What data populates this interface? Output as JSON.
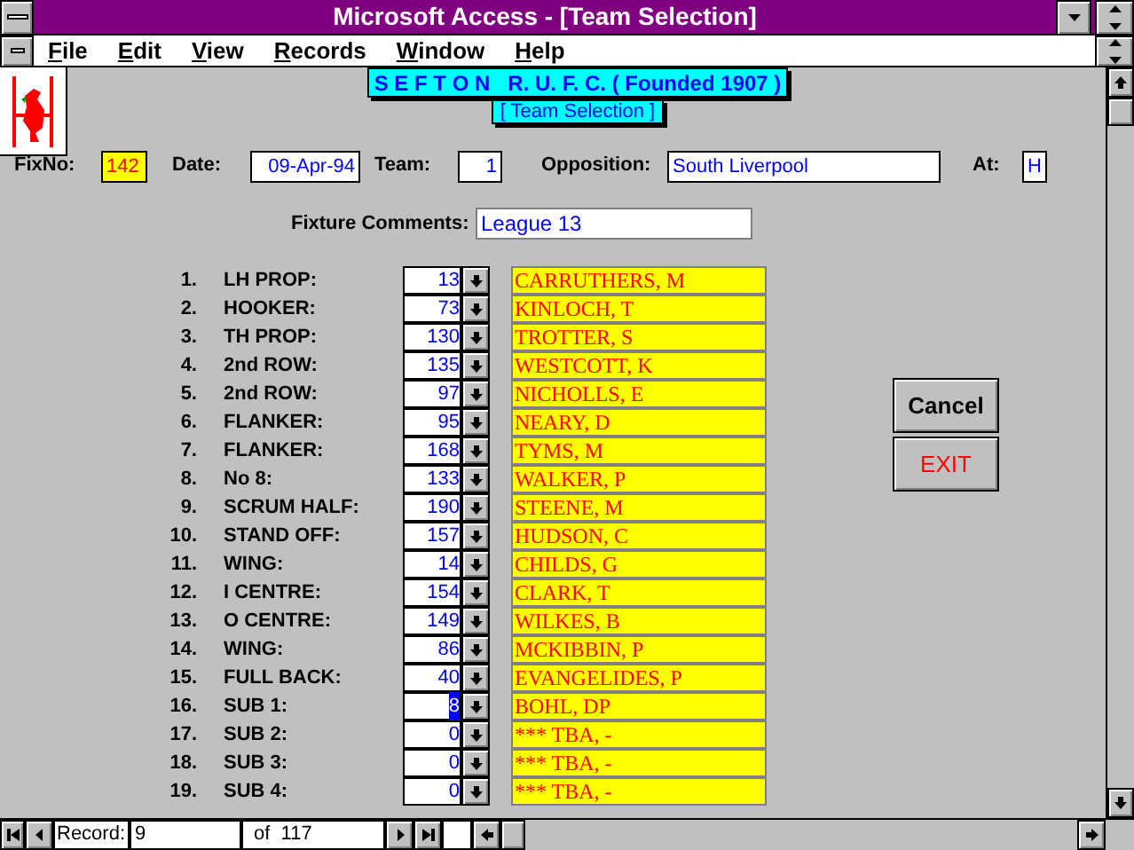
{
  "window": {
    "title": "Microsoft Access - [Team Selection]"
  },
  "menu": [
    "File",
    "Edit",
    "View",
    "Records",
    "Window",
    "Help"
  ],
  "form": {
    "club_title": "S E F T O N   R. U. F. C. ( Founded 1907 )",
    "subtitle": "[ Team Selection ]",
    "fields": [
      {
        "label": "FixNo:",
        "value": "142",
        "kind": "highlight"
      },
      {
        "label": "Date:",
        "value": "09-Apr-94",
        "kind": "right"
      },
      {
        "label": "Team:",
        "value": "1",
        "kind": "right"
      },
      {
        "label": "Opposition:",
        "value": "South Liverpool",
        "kind": "left"
      },
      {
        "label": "At:",
        "value": "H",
        "kind": "left"
      }
    ],
    "comments": {
      "label": "Fixture Comments:",
      "value": "League 13"
    },
    "positions": [
      {
        "number": "1.",
        "position": "LH PROP:",
        "player_id": "13",
        "player_name": "CARRUTHERS, M",
        "focused": false
      },
      {
        "number": "2.",
        "position": "HOOKER:",
        "player_id": "73",
        "player_name": "KINLOCH, T",
        "focused": false
      },
      {
        "number": "3.",
        "position": "TH PROP:",
        "player_id": "130",
        "player_name": "TROTTER, S",
        "focused": false
      },
      {
        "number": "4.",
        "position": "2nd ROW:",
        "player_id": "135",
        "player_name": "WESTCOTT, K",
        "focused": false
      },
      {
        "number": "5.",
        "position": "2nd ROW:",
        "player_id": "97",
        "player_name": "NICHOLLS, E",
        "focused": false
      },
      {
        "number": "6.",
        "position": "FLANKER:",
        "player_id": "95",
        "player_name": "NEARY, D",
        "focused": false
      },
      {
        "number": "7.",
        "position": "FLANKER:",
        "player_id": "168",
        "player_name": "TYMS, M",
        "focused": false
      },
      {
        "number": "8.",
        "position": "No 8:",
        "player_id": "133",
        "player_name": "WALKER, P",
        "focused": false
      },
      {
        "number": "9.",
        "position": "SCRUM HALF:",
        "player_id": "190",
        "player_name": "STEENE, M",
        "focused": false
      },
      {
        "number": "10.",
        "position": "STAND OFF:",
        "player_id": "157",
        "player_name": "HUDSON, C",
        "focused": false
      },
      {
        "number": "11.",
        "position": "WING:",
        "player_id": "14",
        "player_name": "CHILDS, G",
        "focused": false
      },
      {
        "number": "12.",
        "position": "I CENTRE:",
        "player_id": "154",
        "player_name": "CLARK, T",
        "focused": false
      },
      {
        "number": "13.",
        "position": "O CENTRE:",
        "player_id": "149",
        "player_name": "WILKES, B",
        "focused": false
      },
      {
        "number": "14.",
        "position": "WING:",
        "player_id": "86",
        "player_name": "MCKIBBIN, P",
        "focused": false
      },
      {
        "number": "15.",
        "position": "FULL BACK:",
        "player_id": "40",
        "player_name": "EVANGELIDES, P",
        "focused": false
      },
      {
        "number": "16.",
        "position": "SUB 1:",
        "player_id": "8",
        "player_name": "BOHL, DP",
        "focused": true
      },
      {
        "number": "17.",
        "position": "SUB 2:",
        "player_id": "0",
        "player_name": "*** TBA, -",
        "focused": false
      },
      {
        "number": "18.",
        "position": "SUB 3:",
        "player_id": "0",
        "player_name": "*** TBA, -",
        "focused": false
      },
      {
        "number": "19.",
        "position": "SUB 4:",
        "player_id": "0",
        "player_name": "*** TBA, -",
        "focused": false
      }
    ],
    "buttons": [
      {
        "label": "Cancel",
        "kind": "cancel"
      },
      {
        "label": "EXIT",
        "kind": "exit"
      }
    ]
  },
  "navigation": {
    "record_label": "Record:",
    "record": "9",
    "of": "of  117"
  }
}
